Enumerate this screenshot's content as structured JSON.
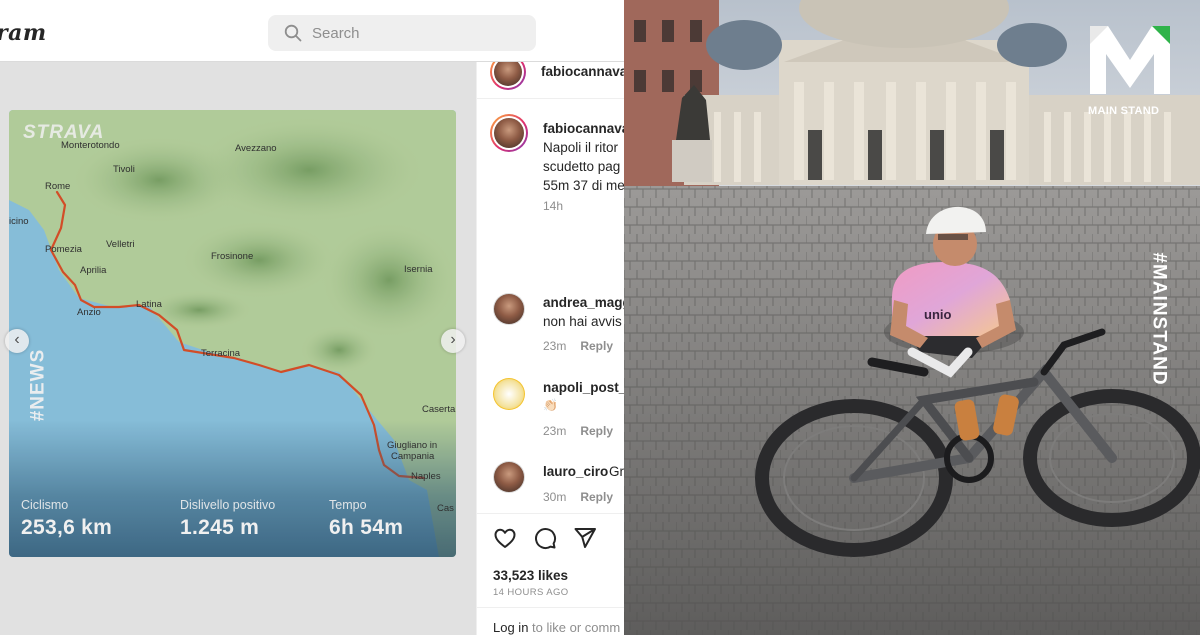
{
  "instagram": {
    "logo_text": "ram",
    "search": {
      "placeholder": "Search"
    },
    "strava_card": {
      "brand": "STRAVA",
      "towns": [
        "Monterotondo",
        "Tivoli",
        "Avezzano",
        "Rome",
        "icino",
        "Pomezia",
        "Velletri",
        "Frosinone",
        "Aprilia",
        "Isernia",
        "Latina",
        "Anzio",
        "Terracina",
        "Caserta",
        "Giugliano in",
        "Campania",
        "Naples",
        "Cas"
      ],
      "stats": [
        {
          "label": "Ciclismo",
          "value": "253,6 km"
        },
        {
          "label": "Dislivello positivo",
          "value": "1.245 m"
        },
        {
          "label": "Tempo",
          "value": "6h 54m"
        }
      ]
    },
    "post": {
      "header_username": "fabiocannava",
      "caption_username": "fabiocannava",
      "caption_lines": [
        "Napoli il ritor",
        "scudetto pag",
        "55m 37 di me"
      ],
      "caption_time": "14h"
    },
    "comments": [
      {
        "username": "andrea_magg",
        "text": "non hai avvis",
        "time": "23m",
        "reply": "Reply"
      },
      {
        "username": "napoli_post_",
        "text": "👏🏻",
        "time": "23m",
        "reply": "Reply"
      },
      {
        "username": "lauro_ciro",
        "text": "Gr",
        "time": "30m",
        "reply": "Reply"
      }
    ],
    "likes": "33,523 likes",
    "posted_ago": "14 HOURS AGO",
    "login_link": "Log in",
    "login_rest": " to like or comm"
  },
  "overlays": {
    "news_tag": "#NEWS",
    "brand_name": "MAIN STAND",
    "mainstand_tag": "#MAINSTAND"
  },
  "colors": {
    "route": "#e0522a",
    "sea": "#8fc9e6",
    "land": "#bcd8a3",
    "brand_green": "#2fb34a"
  }
}
